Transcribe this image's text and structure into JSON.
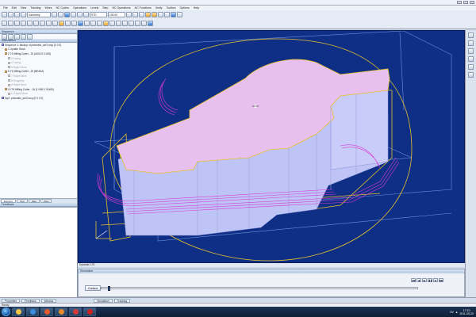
{
  "menu": [
    "File",
    "Edit",
    "View",
    "Tracking",
    "Wires",
    "NC Cycles",
    "Operations",
    "Levels",
    "Step",
    "NC Operations",
    "NC Functions",
    "Verify",
    "Toolbox",
    "Options",
    "Help"
  ],
  "toolbar": {
    "combo1": "Geometry",
    "combo2": "STD",
    "combo3": "100.00"
  },
  "panels": {
    "sequence_title": "Sequence",
    "instructions_title": "Instructions",
    "feedback_title": "Feedback"
  },
  "tree": [
    {
      "label": "Sequence 1: backup of prismatic_ser3 mcp (0 0 0)",
      "icon": "sequence-icon",
      "active": true
    },
    {
      "label": "1 Update Stock",
      "icon": "stock-icon",
      "active": true
    },
    {
      "label": "2 T3 Milling Cutter - 20 (A001/2 0.030)",
      "icon": "operation-icon",
      "active": true
    },
    {
      "label": "3 Facing",
      "icon": "operation-icon",
      "active": false
    },
    {
      "label": "4 Facing",
      "icon": "operation-icon",
      "active": false
    },
    {
      "label": "5 Rapid Move",
      "icon": "operation-icon",
      "active": false
    },
    {
      "label": "6 T4 Milling Cutter - 20 (BEA04)",
      "icon": "operation-icon",
      "active": true
    },
    {
      "label": "7 Rapid Move",
      "icon": "operation-icon",
      "active": false
    },
    {
      "label": "8 Roughing",
      "icon": "operation-icon",
      "active": false
    },
    {
      "label": "9 Rapid Move",
      "icon": "operation-icon",
      "active": false
    },
    {
      "label": "10 T6 Milling Cutter - 16 (1 N55 1 31483)",
      "icon": "operation-icon",
      "active": true
    },
    {
      "label": "11 Rapid Move",
      "icon": "operation-icon",
      "active": false
    },
    {
      "label": "mp2: prismatic_ser3.mcp (0 0 0 0)",
      "icon": "sequence-icon",
      "active": true
    }
  ],
  "panel_tabs": [
    "Explorer",
    "Tool",
    "Step",
    "View"
  ],
  "viewport_status": "Dynamic 176",
  "simulation": {
    "title": "Simulation",
    "context_button": "Context",
    "slider_value": 0.02
  },
  "bottom_tabs": [
    "Properties",
    "Feedback",
    "Window",
    "Simulation",
    "Tracking"
  ],
  "status": "Ready",
  "tray": {
    "lang": "SV",
    "time": "17:10",
    "date": "2011-05-20"
  },
  "colors": {
    "viewport": "#0f2f86",
    "part_top": "#e8bff0",
    "part_side": "#c0c4f8",
    "toolpath": "#d83ad6",
    "outline": "#e6c22a"
  }
}
